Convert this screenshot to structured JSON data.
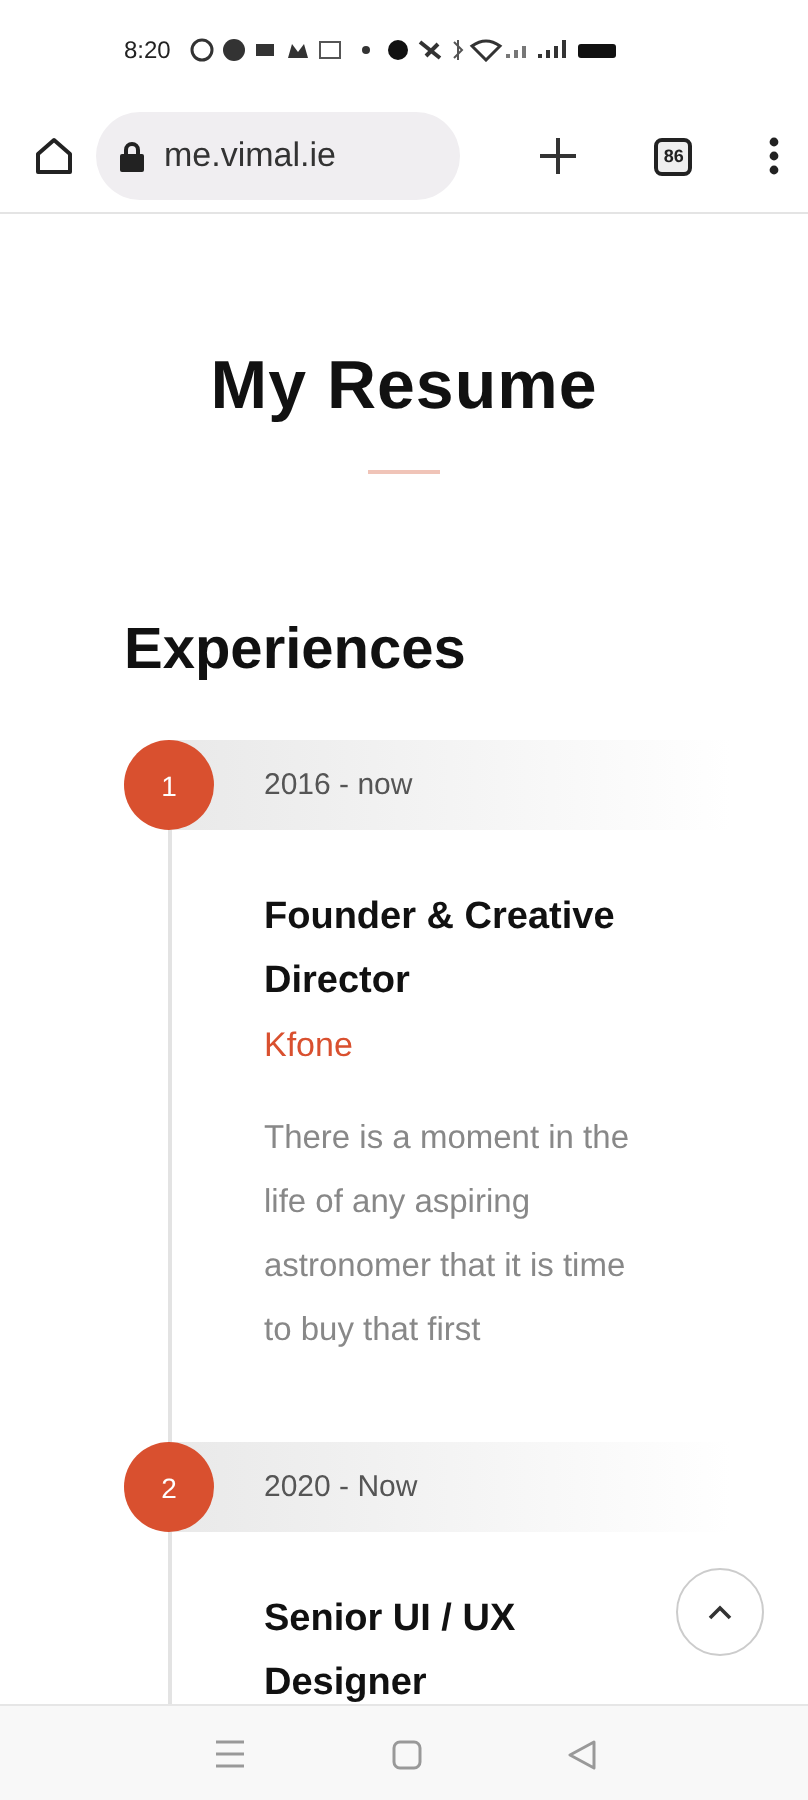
{
  "status_bar": {
    "time": "8:20"
  },
  "browser": {
    "url": "me.vimal.ie",
    "tab_count": "86"
  },
  "page": {
    "title": "My Resume",
    "section_title": "Experiences",
    "experiences": [
      {
        "number": "1",
        "period": "2016 - now",
        "role": "Founder & Creative Director",
        "company": "Kfone",
        "description": "There is a moment in the life of any aspiring astronomer that it is time to buy that first"
      },
      {
        "number": "2",
        "period": "2020 - Now",
        "role": "Senior UI / UX Designer"
      }
    ]
  }
}
